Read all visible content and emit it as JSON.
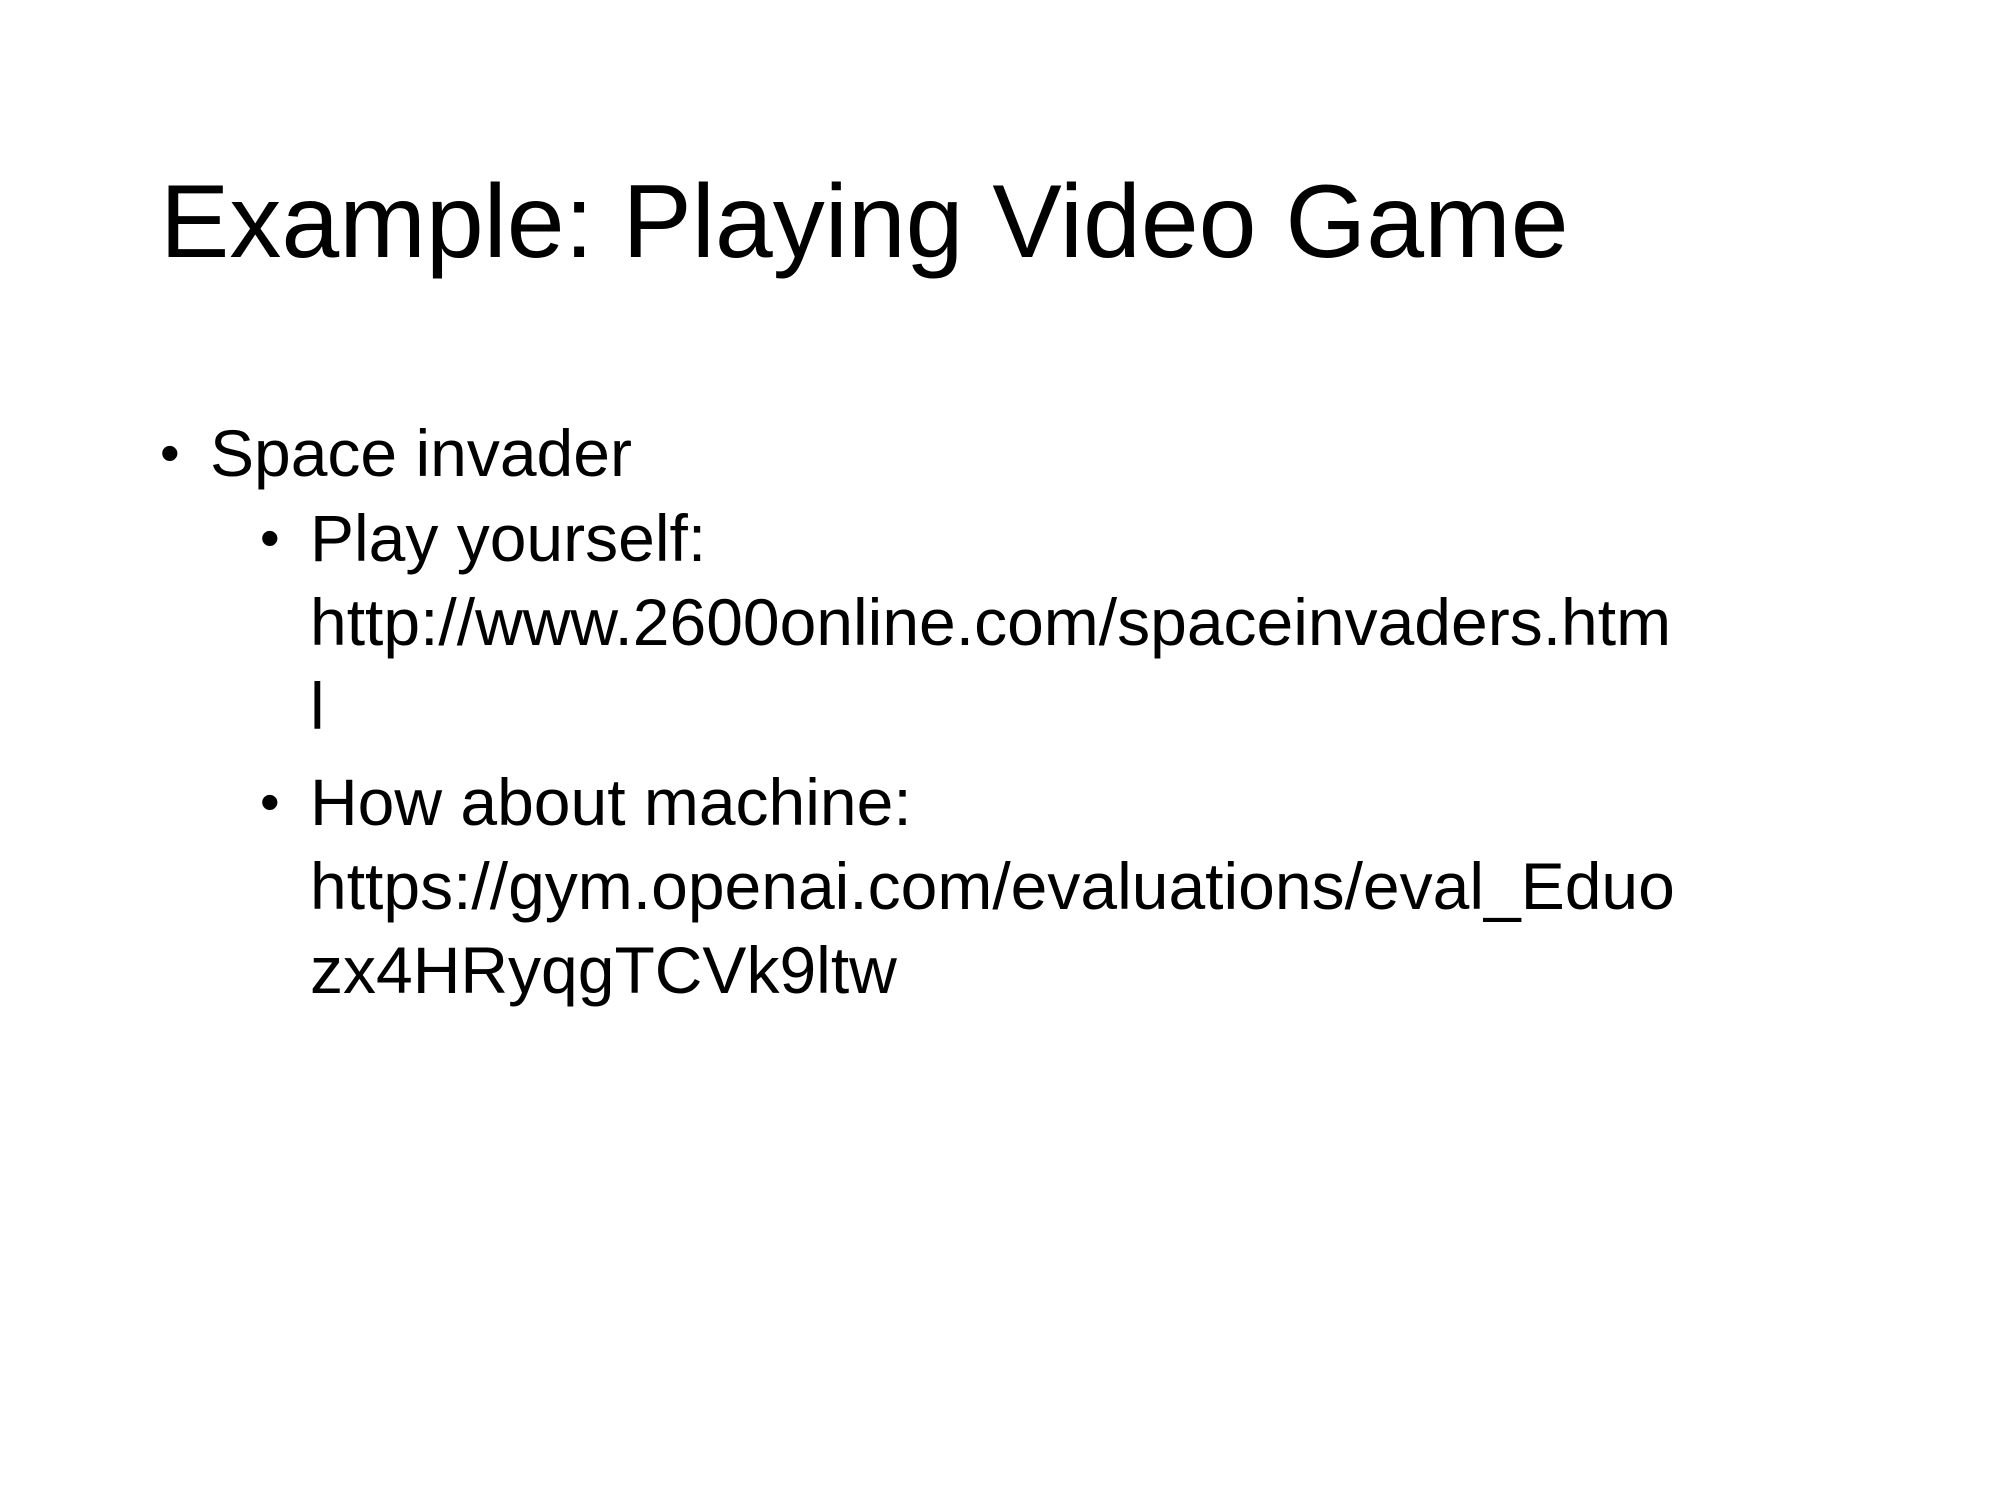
{
  "slide": {
    "title": "Example: Playing Video Game",
    "bullets": [
      {
        "text": "Space invader",
        "children": [
          {
            "label": "Play yourself:",
            "url_line1": "http://www.2600online.com/spaceinvaders.htm",
            "url_line2": "l"
          },
          {
            "label": "How about machine:",
            "url_line1": "https://gym.openai.com/evaluations/eval_Eduo",
            "url_line2": "zx4HRyqgTCVk9ltw"
          }
        ]
      }
    ]
  },
  "bullet_glyph": "•"
}
